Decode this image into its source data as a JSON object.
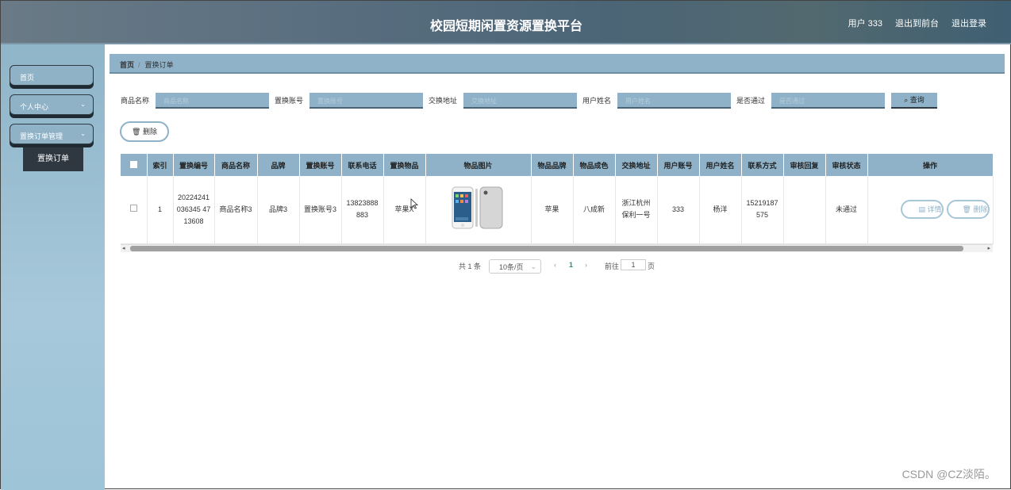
{
  "header": {
    "title": "校园短期闲置资源置换平台",
    "user": "用户 333",
    "front": "退出到前台",
    "logout": "退出登录"
  },
  "sidebar": {
    "items": [
      {
        "label": "首页"
      },
      {
        "label": "个人中心"
      },
      {
        "label": "置换订单管理"
      }
    ],
    "subitem": "置换订单"
  },
  "breadcrumb": {
    "home": "首页",
    "current": "置换订单"
  },
  "search": {
    "fields": [
      {
        "label": "商品名称",
        "placeholder": "商品名称"
      },
      {
        "label": "置换账号",
        "placeholder": "置换账号"
      },
      {
        "label": "交换地址",
        "placeholder": "交换地址"
      },
      {
        "label": "用户姓名",
        "placeholder": "用户姓名"
      },
      {
        "label": "是否通过",
        "placeholder": "是否通过"
      }
    ],
    "query_label": "查询"
  },
  "toolbar": {
    "delete_label": "删除"
  },
  "table": {
    "headers": [
      "",
      "索引",
      "置换编号",
      "商品名称",
      "品牌",
      "置换账号",
      "联系电话",
      "置换物品",
      "物品图片",
      "物品品牌",
      "物品成色",
      "交换地址",
      "用户账号",
      "用户姓名",
      "联系方式",
      "审核回复",
      "审核状态",
      "操作"
    ],
    "rows": [
      {
        "index": "1",
        "order_no": "20224241036345 4713608",
        "product": "商品名称3",
        "brand": "品牌3",
        "account": "置换账号3",
        "phone": "13823888883",
        "item": "苹果X",
        "item_brand": "苹果",
        "condition": "八成新",
        "address": "浙江杭州保利一号",
        "user_account": "333",
        "user_name": "杨洋",
        "contact": "15219187575",
        "reply": "",
        "status": "未通过"
      }
    ],
    "detail_label": "详情",
    "row_delete_label": "删除"
  },
  "pager": {
    "total": "共 1 条",
    "page_size": "10条/页",
    "current": "1",
    "goto": "前往",
    "page_input": "1",
    "page_unit": "页"
  },
  "watermark": "CSDN @CZ淡陌。"
}
